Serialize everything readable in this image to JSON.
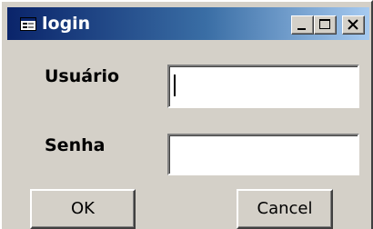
{
  "window": {
    "title": "login",
    "title_icon": "form-window-icon",
    "controls": {
      "minimize_icon": "minimize-icon",
      "maximize_icon": "maximize-icon",
      "close_icon": "close-icon"
    }
  },
  "form": {
    "username_label": "Usuário",
    "username_value": "",
    "password_label": "Senha",
    "password_value": ""
  },
  "buttons": {
    "ok_label": "OK",
    "cancel_label": "Cancel"
  },
  "colors": {
    "face": "#d4d0c8",
    "title_active_start": "#0a246a",
    "title_active_end": "#a6caf0",
    "title_text": "#ffffff"
  }
}
